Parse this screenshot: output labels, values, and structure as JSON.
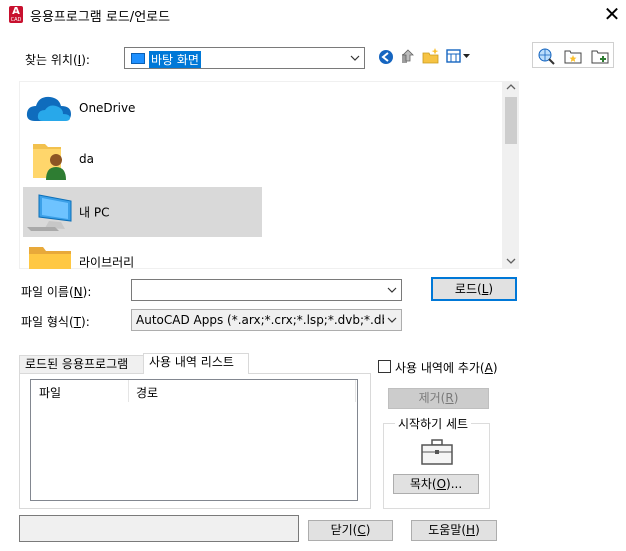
{
  "window": {
    "title": "응용프로그램 로드/언로드",
    "close_glyph": "✕"
  },
  "look_in": {
    "label": "찾는 위치(",
    "hotkey": "I",
    "label_end": "):",
    "value": "바탕 화면"
  },
  "places": [
    {
      "label": "OneDrive",
      "icon": "cloud-icon"
    },
    {
      "label": "da",
      "icon": "user-folder-icon"
    },
    {
      "label": "내 PC",
      "icon": "computer-icon",
      "selected": true
    },
    {
      "label": "라이브러리",
      "icon": "library-folder-icon"
    }
  ],
  "filename": {
    "label": "파일 이름(",
    "hotkey": "N",
    "label_end": "):",
    "value": ""
  },
  "filetype": {
    "label": "파일 형식(",
    "hotkey": "T",
    "label_end": "):",
    "value": "AutoCAD Apps (*.arx;*.crx;*.lsp;*.dvb;*.dbx;*.v"
  },
  "buttons": {
    "load": "로드(",
    "load_key": "L",
    "load_end": ")",
    "remove": "제거(",
    "remove_key": "R",
    "remove_end": ")",
    "contents": "목차(",
    "contents_key": "O",
    "contents_end": ")...",
    "close": "닫기(",
    "close_key": "C",
    "close_end": ")",
    "help": "도움말(",
    "help_key": "H",
    "help_end": ")"
  },
  "tabs": {
    "loaded": "로드된 응용프로그램",
    "history": "사용 내역 리스트"
  },
  "history_list": {
    "col_file": "파일",
    "col_path": "경로"
  },
  "add_history": {
    "label": "사용 내역에 추가(",
    "hotkey": "A",
    "label_end": ")",
    "checked": false
  },
  "startup_suite": {
    "title": "시작하기 세트"
  },
  "status_text": ""
}
